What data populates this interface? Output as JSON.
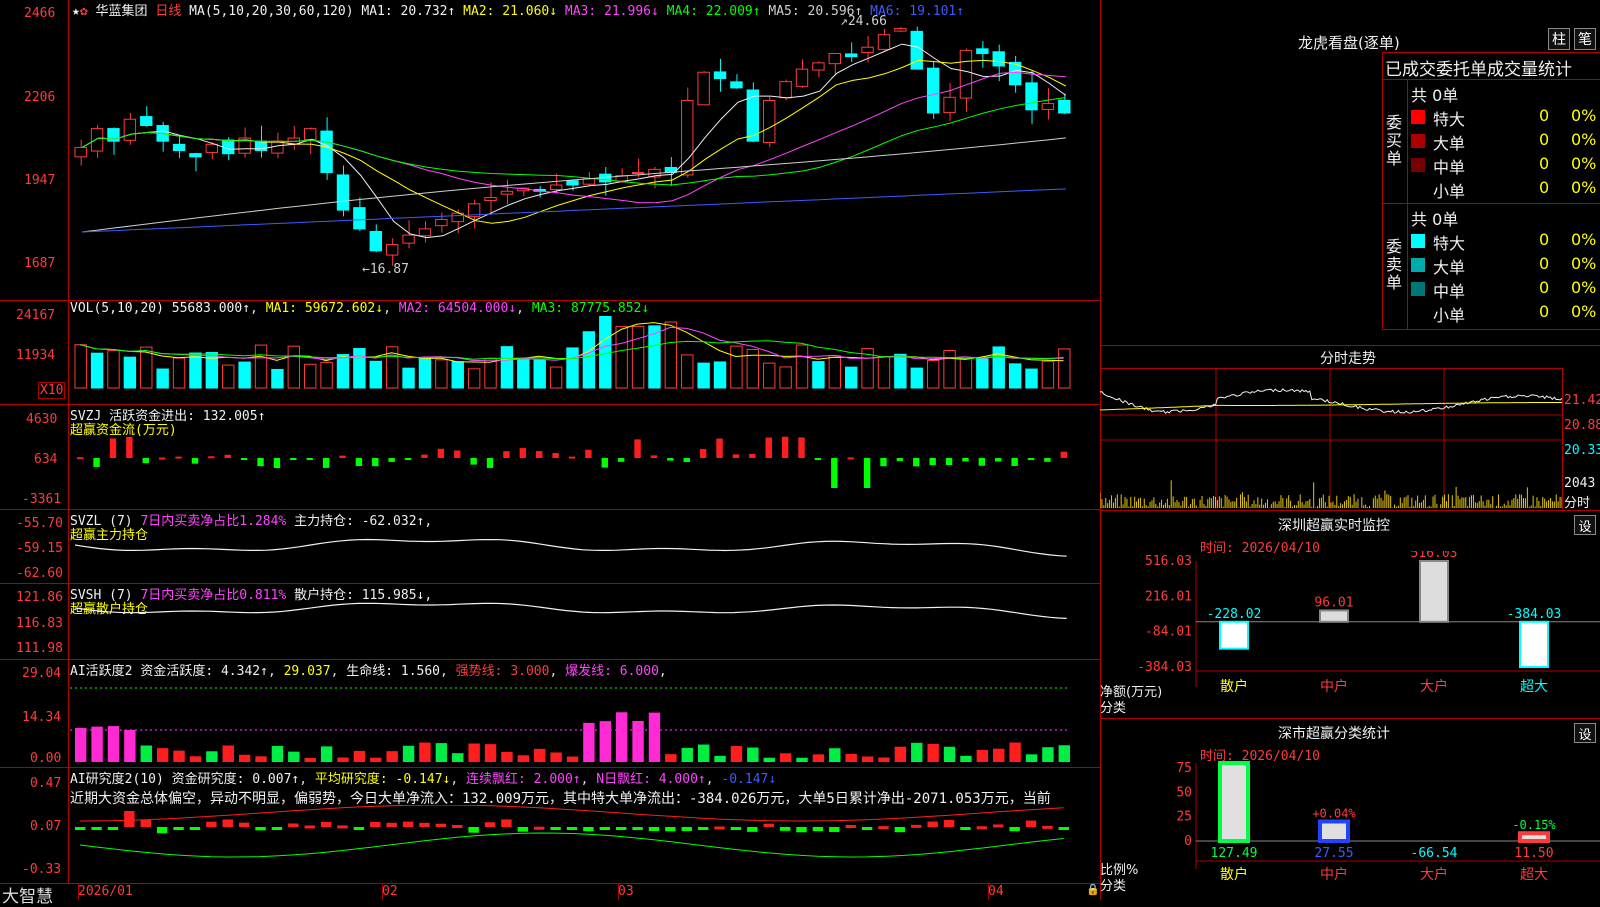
{
  "header": {
    "stock_name": "华蓝集团",
    "period": "日线",
    "ma_params": "MA(5,10,20,30,60,120)",
    "ma1": "MA1: 20.732↑",
    "ma2": "MA2: 21.060↓",
    "ma3": "MA3: 21.996↓",
    "ma4": "MA4: 22.009↑",
    "ma5": "MA5: 20.596↑",
    "ma6": "MA6: 19.101↑"
  },
  "price_pane": {
    "y_ticks": [
      "2466",
      "2206",
      "1947",
      "1687"
    ],
    "high_label": "24.66",
    "low_label": "16.87"
  },
  "vol_pane": {
    "label": "VOL(5,10,20)",
    "value": "55683.000↑",
    "ma1": "MA1: 59672.602↓",
    "ma2": "MA2: 64504.000↓",
    "ma3": "MA3: 87775.852↓",
    "y_ticks": [
      "24167",
      "11934"
    ],
    "unit": "X10"
  },
  "svzj_pane": {
    "label": "SVZJ",
    "text": "活跃资金进出: 132.005↑",
    "sub": "超赢资金流(万元)",
    "y_ticks": [
      "4630",
      "634",
      "-3361"
    ]
  },
  "svzl_pane": {
    "label": "SVZL (7)",
    "text1": "7日内买卖净占比1.284%",
    "text2": "主力持仓: -62.032↑,",
    "sub": "超赢主力持仓",
    "y_ticks": [
      "-55.70",
      "-59.15",
      "-62.60"
    ]
  },
  "svsh_pane": {
    "label": "SVSH (7)",
    "text1": "7日内买卖净占比0.811%",
    "text2": "散户持仓: 115.985↓,",
    "sub": "超赢散户持仓",
    "y_ticks": [
      "121.86",
      "116.83",
      "111.98"
    ]
  },
  "ai1_pane": {
    "label": "AI活跃度2",
    "text1": "资金活跃度: 4.342↑",
    "text2": "29.037",
    "text3": "生命线: 1.560",
    "text4": "强势线: 3.000",
    "text5": "爆发线: 6.000",
    "y_ticks": [
      "29.04",
      "14.34",
      "0.00"
    ]
  },
  "ai2_pane": {
    "label": "AI研究度2(10)",
    "text1": "资金研究度: 0.007↑",
    "text2": "平均研究度: -0.147↓",
    "text3": "连续飘红: 2.000↑",
    "text4": "N日飘红: 4.000↑",
    "text5": "-0.147↓",
    "summary": "近期大资金总体偏空，异动不明显，偏弱势，今日大单净流入：132.009万元，其中特大单净流出：-384.026万元，大单5日累计净出-2071.053万元，当前",
    "y_ticks": [
      "0.47",
      "0.07",
      "-0.33"
    ]
  },
  "x_axis": {
    "brand": "大智慧",
    "labels": [
      "2026/01",
      "02",
      "03",
      "04"
    ]
  },
  "dragon": {
    "title": "龙虎看盘(逐单)",
    "btn1": "柱",
    "btn2": "笔",
    "subtitle": "已成交委托单成交量统计",
    "buy_side": "委买单",
    "sell_side": "委卖单",
    "buy_total": "共 0单",
    "sell_total": "共 0单",
    "buy_rows": [
      {
        "name": "特大",
        "count": "0",
        "pct": "0%",
        "color": "#ff0000"
      },
      {
        "name": "大单",
        "count": "0",
        "pct": "0%",
        "color": "#aa0000"
      },
      {
        "name": "中单",
        "count": "0",
        "pct": "0%",
        "color": "#770000"
      },
      {
        "name": "小单",
        "count": "0",
        "pct": "0%",
        "color": "#000000"
      }
    ],
    "sell_rows": [
      {
        "name": "特大",
        "count": "0",
        "pct": "0%",
        "color": "#00ffff"
      },
      {
        "name": "大单",
        "count": "0",
        "pct": "0%",
        "color": "#00aaaa"
      },
      {
        "name": "中单",
        "count": "0",
        "pct": "0%",
        "color": "#007777"
      },
      {
        "name": "小单",
        "count": "0",
        "pct": "0%",
        "color": "#000000"
      }
    ]
  },
  "intraday": {
    "title": "分时走势",
    "ticks": [
      "21.42",
      "20.88",
      "20.33"
    ],
    "vol_tick": "2043",
    "vol_label": "分时"
  },
  "monitor": {
    "title": "深圳超赢实时监控",
    "btn": "设",
    "time": "时间: 2026/04/10",
    "y_ticks": [
      "516.03",
      "216.01",
      "-84.01",
      "-384.03"
    ],
    "ylabel1": "净额(万元)",
    "ylabel2": "分类",
    "categories": [
      "散户",
      "中户",
      "大户",
      "超大"
    ],
    "values": [
      -228.02,
      96.01,
      516.03,
      -384.03
    ],
    "value_labels": [
      "-228.02",
      "96.01",
      "516.03",
      "-384.03"
    ]
  },
  "classify": {
    "title": "深市超赢分类统计",
    "btn": "设",
    "time": "时间: 2026/04/10",
    "y_ticks": [
      "75",
      "50",
      "25",
      "0"
    ],
    "ylabel1": "比例%",
    "ylabel2": "分类",
    "categories": [
      "散户",
      "中户",
      "大户",
      "超大"
    ],
    "bottom_values": [
      "127.49",
      "27.55",
      "-66.54",
      "11.50"
    ],
    "pct_labels": [
      "+0.04%",
      "-0.15%"
    ]
  },
  "colors": {
    "up": "#ff3b3b",
    "down": "#00ffff",
    "border": "#b00000"
  }
}
